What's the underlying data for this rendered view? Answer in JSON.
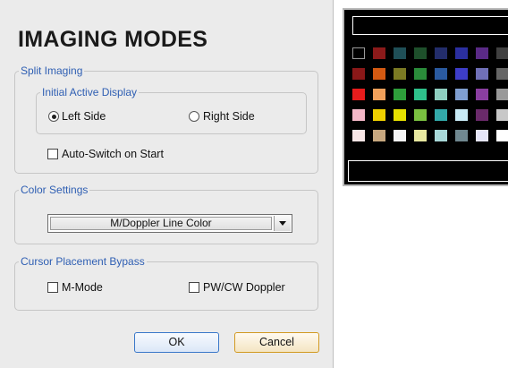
{
  "dialog": {
    "title": "IMAGING MODES",
    "split_imaging": {
      "legend": "Split Imaging",
      "initial_display": {
        "legend": "Initial Active Display",
        "left_label": "Left Side",
        "right_label": "Right Side",
        "selected": "Left Side"
      },
      "auto_switch_label": "Auto-Switch on Start",
      "auto_switch_checked": false
    },
    "color_settings": {
      "legend": "Color Settings",
      "selected_value": "M/Doppler Line Color"
    },
    "cursor_bypass": {
      "legend": "Cursor Placement Bypass",
      "m_mode_label": "M-Mode",
      "m_mode_checked": false,
      "pwcw_label": "PW/CW Doppler",
      "pwcw_checked": false
    },
    "buttons": {
      "ok": "OK",
      "cancel": "Cancel"
    }
  },
  "palette": {
    "rows": [
      [
        "#000000",
        "#8b1a1a",
        "#1f4f57",
        "#1e4f2b",
        "#232d6b",
        "#2b2fa0",
        "#5a2a86",
        "#404040"
      ],
      [
        "#8a1818",
        "#d45a12",
        "#7b7a23",
        "#2a8c3a",
        "#2a5aa0",
        "#3d3dc9",
        "#7070b8",
        "#666666"
      ],
      [
        "#e81c1c",
        "#f0a05a",
        "#2e9e3a",
        "#2ec08a",
        "#8fcfc0",
        "#7f9ed0",
        "#8a3ea0",
        "#999999"
      ],
      [
        "#f5b8c8",
        "#f0d000",
        "#e6e000",
        "#7ac040",
        "#33aaaa",
        "#c8eaf5",
        "#6a2a6a",
        "#c8c8c8"
      ],
      [
        "#f8e6e6",
        "#c8a880",
        "#f5f5f5",
        "#e8e8a0",
        "#a8d8d8",
        "#708890",
        "#e6e6f8",
        "#ffffff"
      ]
    ]
  }
}
